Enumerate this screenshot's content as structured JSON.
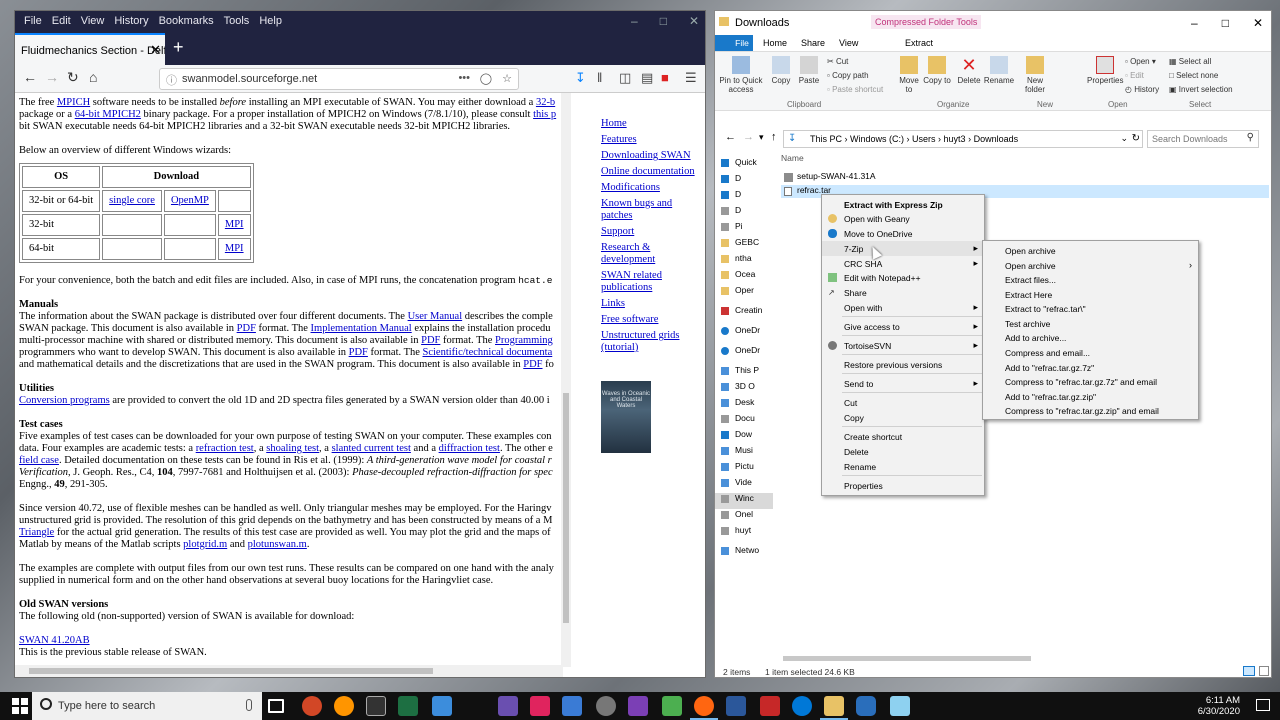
{
  "firefox": {
    "menu": [
      "File",
      "Edit",
      "View",
      "History",
      "Bookmarks",
      "Tools",
      "Help"
    ],
    "tab_title": "Fluidmechanics Section - Delft Uni",
    "url": "swanmodel.sourceforge.net",
    "url_more": "•••",
    "content": {
      "intro1_a": "The free ",
      "intro1_mpich": "MPICH",
      "intro1_b": " software needs to be installed ",
      "intro1_before": "before",
      "intro1_c": " installing an MPI executable of SWAN. You may either download a ",
      "intro1_32": "32-b",
      "intro2_a": "package or a ",
      "intro2_64": "64-bit MPICH2",
      "intro2_b": " binary package. For a proper installation of MPICH2 on Windows (7/8.1/10), please consult ",
      "intro2_this": "this p",
      "intro3": "bit SWAN executable needs 64-bit MPICH2 libraries and a 32-bit SWAN executable needs 32-bit MPICH2 libraries.",
      "overview": "Below an overview of different Windows wizards:",
      "table": {
        "h_os": "OS",
        "h_download": "Download",
        "r1_os": "32-bit or 64-bit",
        "r1_single": "single core",
        "r1_openmp": "OpenMP",
        "r2_os": "32-bit",
        "r2_mpi": "MPI",
        "r3_os": "64-bit",
        "r3_mpi": "MPI"
      },
      "convenience": "For your convenience, both the batch and edit files are included. Also, in case of MPI runs, the concatenation program ",
      "convenience_code": "hcat.e",
      "manuals_h": "Manuals",
      "man1_a": "The information about the SWAN package is distributed over four different documents. The ",
      "man1_user": "User Manual",
      "man1_b": " describes the comple",
      "man2_a": "SWAN package. This document is also available in ",
      "man2_pdf": "PDF",
      "man2_b": " format. The ",
      "man2_impl": "Implementation Manual",
      "man2_c": " explains the installation procedu",
      "man3_a": "multi-processor machine with shared or distributed memory. This document is also available in ",
      "man3_pdf": "PDF",
      "man3_b": " format. The ",
      "man3_prog": "Programming",
      "man4_a": "programmers who want to develop SWAN. This document is also available in ",
      "man4_pdf": "PDF",
      "man4_b": " format. The ",
      "man4_sci": "Scientific/technical documenta",
      "man5_a": "and mathematical details and the discretizations that are used in the SWAN program. This document is also available in ",
      "man5_pdf": "PDF",
      "man5_b": " fo",
      "util_h": "Utilities",
      "util_link": "Conversion programs",
      "util_text": " are provided to convert the old 1D and 2D spectra files generated by a SWAN version older than 40.00 i",
      "test_h": "Test cases",
      "test1": "Five examples of test cases can be downloaded for your own purpose of testing SWAN on your computer. These examples con",
      "test2_a": "data. Four examples are academic tests: a ",
      "test2_refr": "refraction test",
      "test2_b": ", a ",
      "test2_shoal": "shoaling test",
      "test2_c": ", a ",
      "test2_slant": "slanted current test",
      "test2_d": " and a ",
      "test2_diff": "diffraction test",
      "test2_e": ". The other e",
      "test3_field": "field case",
      "test3_a": ". Detailed documentation on these tests can be found in Ris et al. (1999): ",
      "test3_i": "A third-generation wave model for coastal r",
      "test4_i": "Verification",
      "test4_a": ", J. Geoph. Res., C4, ",
      "test4_b": "104",
      "test4_c": ", 7997-7681 and Holthuijsen et al. (2003): ",
      "test4_i2": "Phase-decoupled refraction-diffraction for spec",
      "test5_a": "Engng., ",
      "test5_b": "49",
      "test5_c": ", 291-305.",
      "flex1": "Since version 40.72, use of flexible meshes can be handled as well. Only triangular meshes may be employed. For the Haringv",
      "flex2": "unstructured grid is provided. The resolution of this grid depends on the bathymetry and has been constructed by means of a M",
      "flex3_tri": "Triangle",
      "flex3_a": " for the actual grid generation. The results of this test case are provided as well. You may plot the grid and the maps of",
      "flex4_a": "Matlab by means of the Matlab scripts ",
      "flex4_p1": "plotgrid.m",
      "flex4_b": " and ",
      "flex4_p2": "plotunswan.m",
      "flex4_c": ".",
      "ex1": "The examples are complete with output files from our own test runs. These results can be compared on one hand with the analy",
      "ex2": "supplied in numerical form and on the other hand observations at several buoy locations for the Haringvliet case.",
      "old_h": "Old SWAN versions",
      "old_text": "The following old (non-supported) version of SWAN is available for download:",
      "old_link": "SWAN 41.20AB",
      "old_note": "This is the previous stable release of SWAN."
    },
    "sidenav": [
      "Home",
      "Features",
      "Downloading SWAN",
      "Online documentation",
      "Modifications",
      "Known bugs and patches",
      "Support",
      "Research & development",
      "SWAN related publications",
      "Links",
      "Free software",
      "Unstructured grids (tutorial)"
    ],
    "book_text": "Waves in Oceanic and Coastal Waters"
  },
  "explorer": {
    "title": "Downloads",
    "context_tab": "Compressed Folder Tools",
    "tabs": [
      "File",
      "Home",
      "Share",
      "View",
      "Extract"
    ],
    "ribbon": {
      "pin": "Pin to Quick access",
      "copy": "Copy",
      "paste": "Paste",
      "cut": "Cut",
      "copy_path": "Copy path",
      "paste_shortcut": "Paste shortcut",
      "move_to": "Move to",
      "copy_to": "Copy to",
      "delete": "Delete",
      "rename": "Rename",
      "new_folder": "New folder",
      "properties": "Properties",
      "open": "Open",
      "edit": "Edit",
      "history": "History",
      "select_all": "Select all",
      "select_none": "Select none",
      "invert_selection": "Invert selection",
      "groups": [
        "Clipboard",
        "Organize",
        "New",
        "Open",
        "Select"
      ]
    },
    "address": [
      "This PC",
      "Windows (C:)",
      "Users",
      "huyt3",
      "Downloads"
    ],
    "search_placeholder": "Search Downloads",
    "nav": [
      "Quick",
      "D",
      "D",
      "D",
      "Pi",
      "GEBC",
      "ntha",
      "Ocea",
      "Oper",
      "Creatin",
      "OneDr",
      "OneDr",
      "This P",
      "3D O",
      "Desk",
      "Docu",
      "Dow",
      "Musi",
      "Pictu",
      "Vide",
      "Winc",
      "Onel",
      "huyt",
      "Netwo"
    ],
    "column_name": "Name",
    "files": [
      "setup-SWAN-41.31A",
      "refrac.tar"
    ],
    "status_items": "2 items",
    "status_selected": "1 item selected  24.6 KB"
  },
  "context_menu": {
    "items": [
      "Extract with Express Zip",
      "Open with Geany",
      "Move to OneDrive",
      "7-Zip",
      "CRC SHA",
      "Edit with Notepad++",
      "Share",
      "Open with",
      "Give access to",
      "TortoiseSVN",
      "Restore previous versions",
      "Send to",
      "Cut",
      "Copy",
      "Create shortcut",
      "Delete",
      "Rename",
      "Properties"
    ]
  },
  "submenu_7zip": {
    "items": [
      "Open archive",
      "Open archive",
      "Extract files...",
      "Extract Here",
      "Extract to \"refrac.tar\\\"",
      "Test archive",
      "Add to archive...",
      "Compress and email...",
      "Add to \"refrac.tar.gz.7z\"",
      "Compress to \"refrac.tar.gz.7z\" and email",
      "Add to \"refrac.tar.gz.zip\"",
      "Compress to \"refrac.tar.gz.zip\" and email"
    ]
  },
  "taskbar": {
    "search_placeholder": "Type here to search",
    "time": "6:11 AM",
    "date": "6/30/2020",
    "colors": {
      "accent": "#76b9ed"
    }
  }
}
